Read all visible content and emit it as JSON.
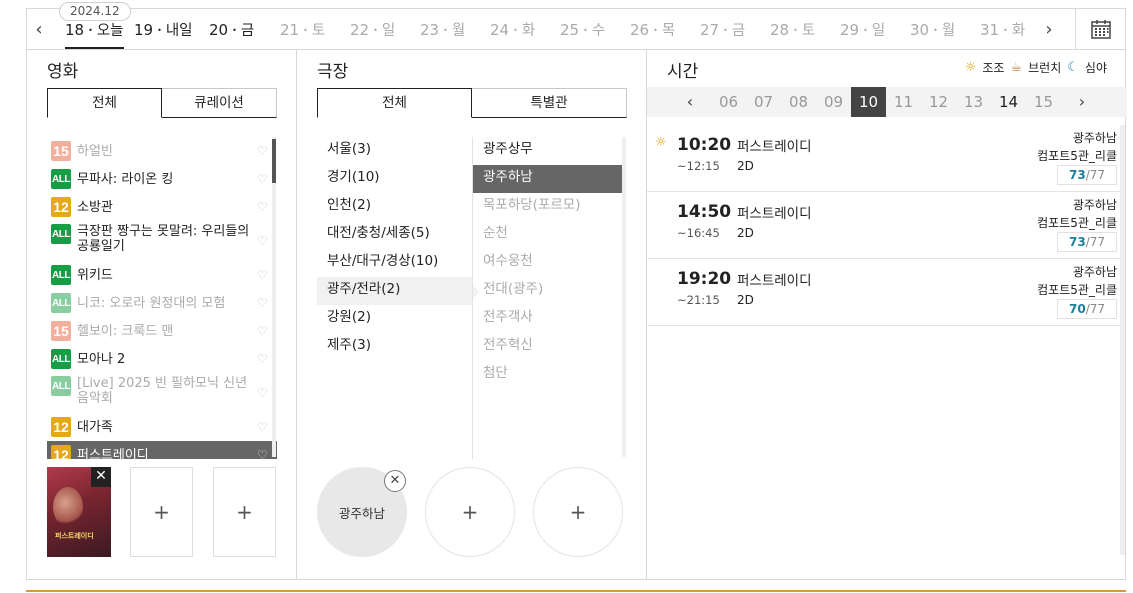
{
  "datebar": {
    "month": "2024.12",
    "days": [
      {
        "num": "18",
        "label": "오늘",
        "state": "today"
      },
      {
        "num": "19",
        "label": "내일",
        "state": "past"
      },
      {
        "num": "20",
        "label": "금",
        "state": "past"
      },
      {
        "num": "21",
        "label": "토",
        "state": "dim"
      },
      {
        "num": "22",
        "label": "일",
        "state": "dim"
      },
      {
        "num": "23",
        "label": "월",
        "state": "dim"
      },
      {
        "num": "24",
        "label": "화",
        "state": "dim"
      },
      {
        "num": "25",
        "label": "수",
        "state": "dim"
      },
      {
        "num": "26",
        "label": "목",
        "state": "dim"
      },
      {
        "num": "27",
        "label": "금",
        "state": "dim"
      },
      {
        "num": "28",
        "label": "토",
        "state": "dim"
      },
      {
        "num": "29",
        "label": "일",
        "state": "dim"
      },
      {
        "num": "30",
        "label": "월",
        "state": "dim"
      },
      {
        "num": "31",
        "label": "화",
        "state": "dim"
      }
    ],
    "prev_icon": "chevron-left-icon",
    "next_icon": "chevron-right-icon",
    "calendar_icon": "calendar-icon"
  },
  "movie": {
    "title": "영화",
    "tabs": [
      "전체",
      "큐레이션"
    ],
    "items": [
      {
        "rating": "15",
        "title": "하얼빈",
        "dim": true,
        "tall": false,
        "selected": false
      },
      {
        "rating": "ALL",
        "title": "무파사: 라이온 킹",
        "dim": false,
        "tall": false,
        "selected": false
      },
      {
        "rating": "12",
        "title": "소방관",
        "dim": false,
        "tall": false,
        "selected": false
      },
      {
        "rating": "ALL",
        "title": "극장판 짱구는 못말려: 우리들의 공룡일기",
        "dim": false,
        "tall": true,
        "selected": false
      },
      {
        "rating": "ALL",
        "title": "위키드",
        "dim": false,
        "tall": false,
        "selected": false
      },
      {
        "rating": "ALL",
        "title": "니코: 오로라 원정대의 모험",
        "dim": true,
        "tall": false,
        "selected": false
      },
      {
        "rating": "15",
        "title": "헬보이: 크룩드 맨",
        "dim": true,
        "tall": false,
        "selected": false
      },
      {
        "rating": "ALL",
        "title": "모아나 2",
        "dim": false,
        "tall": false,
        "selected": false
      },
      {
        "rating": "ALL",
        "title": "[Live] 2025 빈 필하모닉 신년 음악회",
        "dim": true,
        "tall": true,
        "selected": false
      },
      {
        "rating": "12",
        "title": "대가족",
        "dim": false,
        "tall": false,
        "selected": false
      },
      {
        "rating": "12",
        "title": "퍼스트레이디",
        "dim": false,
        "tall": false,
        "selected": true
      }
    ],
    "poster_text": "퍼스트레이디",
    "add_label": "+"
  },
  "theater": {
    "title": "극장",
    "tabs": [
      "전체",
      "특별관"
    ],
    "regions": [
      {
        "label": "서울(3)",
        "active": false
      },
      {
        "label": "경기(10)",
        "active": false
      },
      {
        "label": "인천(2)",
        "active": false
      },
      {
        "label": "대전/충청/세종(5)",
        "active": false
      },
      {
        "label": "부산/대구/경상(10)",
        "active": false
      },
      {
        "label": "광주/전라(2)",
        "active": true
      },
      {
        "label": "강원(2)",
        "active": false
      },
      {
        "label": "제주(3)",
        "active": false
      }
    ],
    "theaters": [
      {
        "label": "광주상무",
        "state": "normal"
      },
      {
        "label": "광주하남",
        "state": "selected"
      },
      {
        "label": "목포하당(포르모)",
        "state": "dim"
      },
      {
        "label": "순천",
        "state": "dim"
      },
      {
        "label": "여수웅천",
        "state": "dim"
      },
      {
        "label": "전대(광주)",
        "state": "dim"
      },
      {
        "label": "전주객사",
        "state": "dim"
      },
      {
        "label": "전주혁신",
        "state": "dim"
      },
      {
        "label": "첨단",
        "state": "dim"
      }
    ],
    "selected_slot": "광주하남",
    "add_label": "+"
  },
  "time": {
    "title": "시간",
    "legend": [
      {
        "icon": "sun-icon",
        "glyph": "☼",
        "label": "조조",
        "color": "#e69a00"
      },
      {
        "icon": "coffee-icon",
        "glyph": "☕",
        "label": "브런치",
        "color": "#b7803a"
      },
      {
        "icon": "moon-icon",
        "glyph": "☾",
        "label": "심야",
        "color": "#2a8fc4"
      }
    ],
    "hours": [
      {
        "label": "06",
        "state": "none"
      },
      {
        "label": "07",
        "state": "none"
      },
      {
        "label": "08",
        "state": "none"
      },
      {
        "label": "09",
        "state": "none"
      },
      {
        "label": "10",
        "state": "selected"
      },
      {
        "label": "11",
        "state": "none"
      },
      {
        "label": "12",
        "state": "none"
      },
      {
        "label": "13",
        "state": "none"
      },
      {
        "label": "14",
        "state": "avail"
      },
      {
        "label": "15",
        "state": "none"
      }
    ],
    "shows": [
      {
        "start": "10:20",
        "end": "~12:15",
        "title": "퍼스트레이디",
        "format": "2D",
        "theater": "광주하남",
        "hall": "컴포트5관_리클",
        "remain": "73",
        "total": "/77",
        "morning": true
      },
      {
        "start": "14:50",
        "end": "~16:45",
        "title": "퍼스트레이디",
        "format": "2D",
        "theater": "광주하남",
        "hall": "컴포트5관_리클",
        "remain": "73",
        "total": "/77",
        "morning": false
      },
      {
        "start": "19:20",
        "end": "~21:15",
        "title": "퍼스트레이디",
        "format": "2D",
        "theater": "광주하남",
        "hall": "컴포트5관_리클",
        "remain": "70",
        "total": "/77",
        "morning": false
      }
    ]
  },
  "colors": {
    "accent": "#e09a28",
    "selected": "#666666",
    "seats": "#1a7f9c"
  }
}
